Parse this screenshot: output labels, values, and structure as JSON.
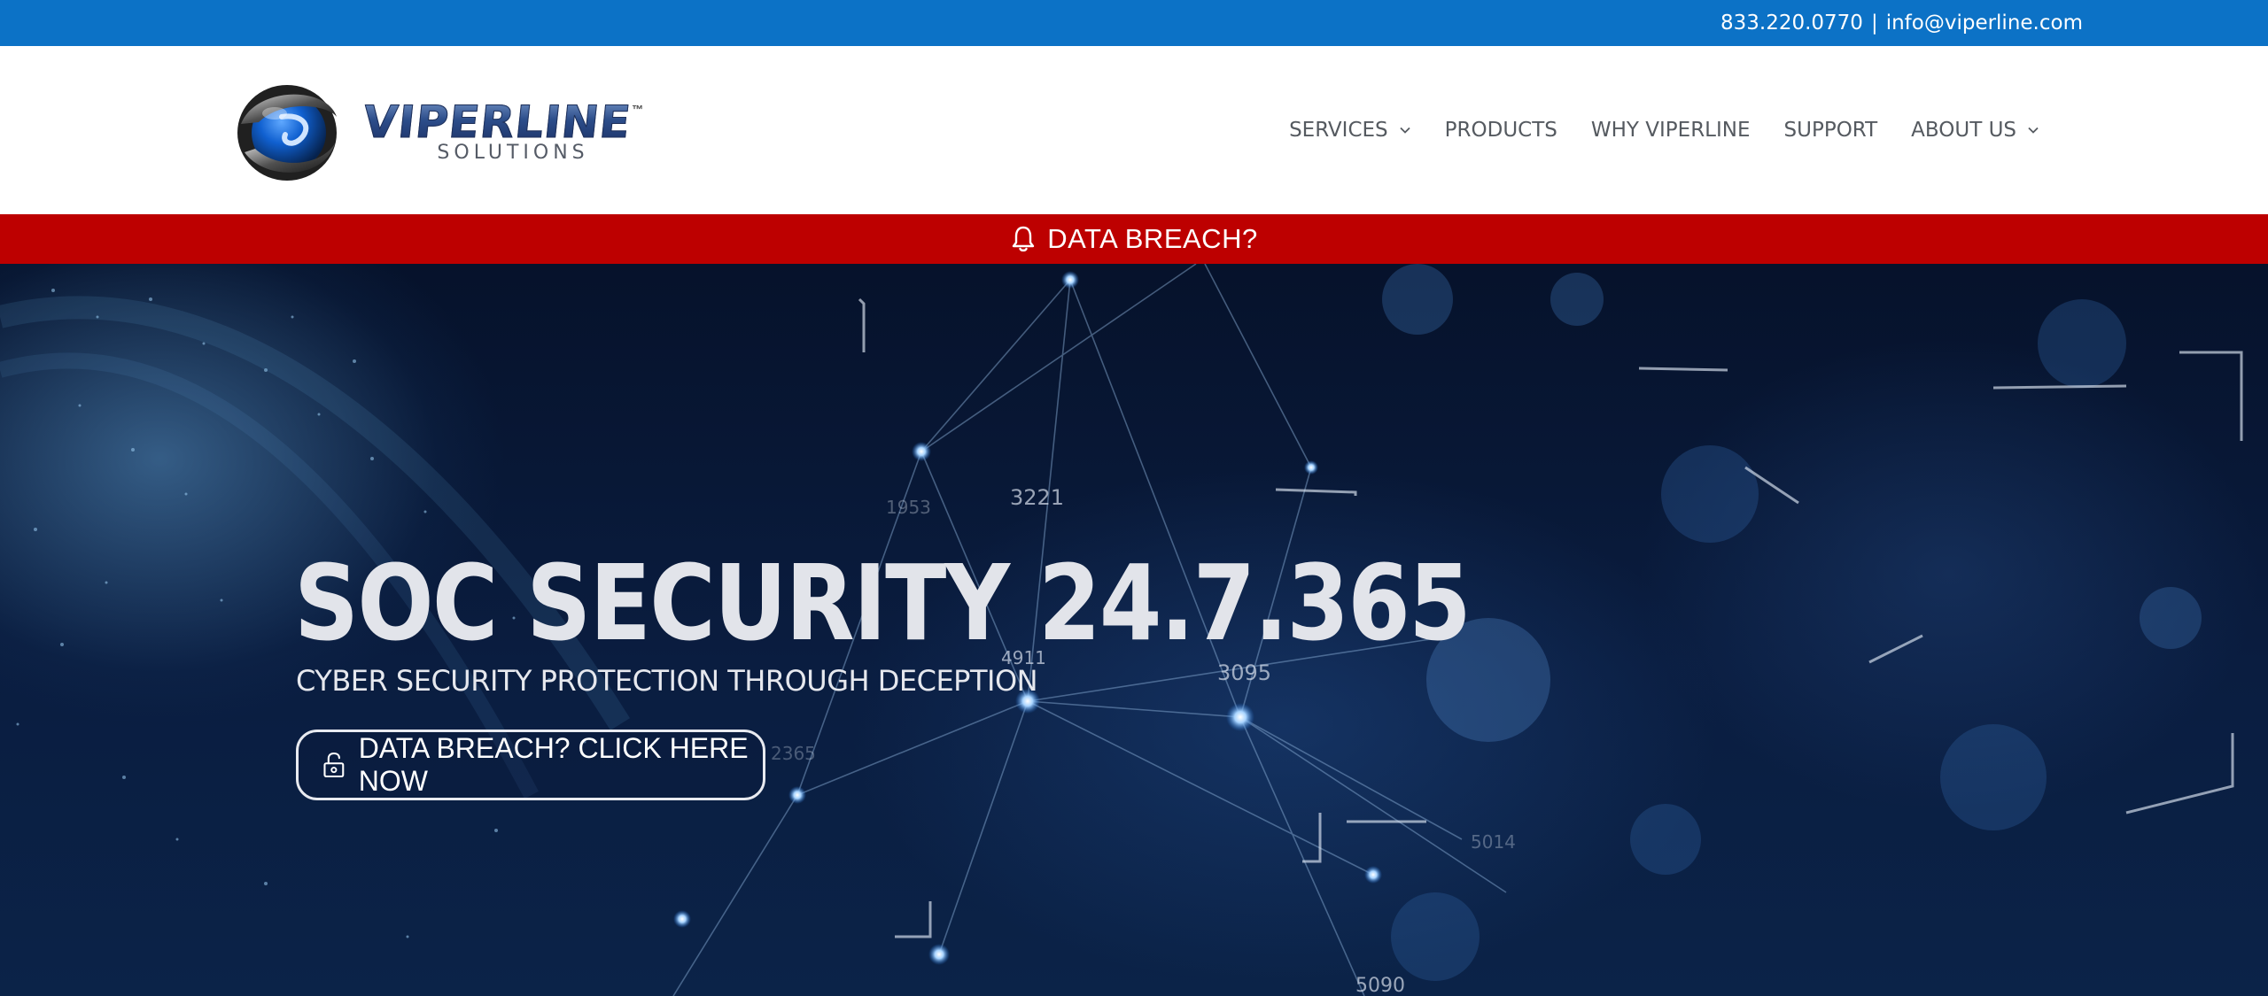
{
  "topbar": {
    "phone": "833.220.0770",
    "separator": "|",
    "email": "info@viperline.com"
  },
  "header": {
    "logo": {
      "name": "VIPERLINE",
      "trademark": "™",
      "tagline": "SOLUTIONS"
    },
    "nav": [
      {
        "label": "SERVICES",
        "has_dropdown": true
      },
      {
        "label": "PRODUCTS",
        "has_dropdown": false
      },
      {
        "label": "WHY VIPERLINE",
        "has_dropdown": false
      },
      {
        "label": "SUPPORT",
        "has_dropdown": false
      },
      {
        "label": "ABOUT US",
        "has_dropdown": true
      }
    ]
  },
  "alert": {
    "icon": "bell-icon",
    "label": "DATA BREACH?"
  },
  "hero": {
    "title": "SOC SECURITY 24.7.365",
    "subtitle": "CYBER SECURITY PROTECTION THROUGH DECEPTION",
    "cta": {
      "icon": "unlock-icon",
      "label": "DATA BREACH? CLICK HERE NOW"
    },
    "background_numbers": [
      "3221",
      "1953",
      "4911",
      "3095",
      "5090",
      "5014",
      "2365"
    ]
  },
  "colors": {
    "topbar": "#0c72c6",
    "alert": "#bd0000",
    "hero_bg": "#06122b",
    "nav_text": "#555a60"
  }
}
